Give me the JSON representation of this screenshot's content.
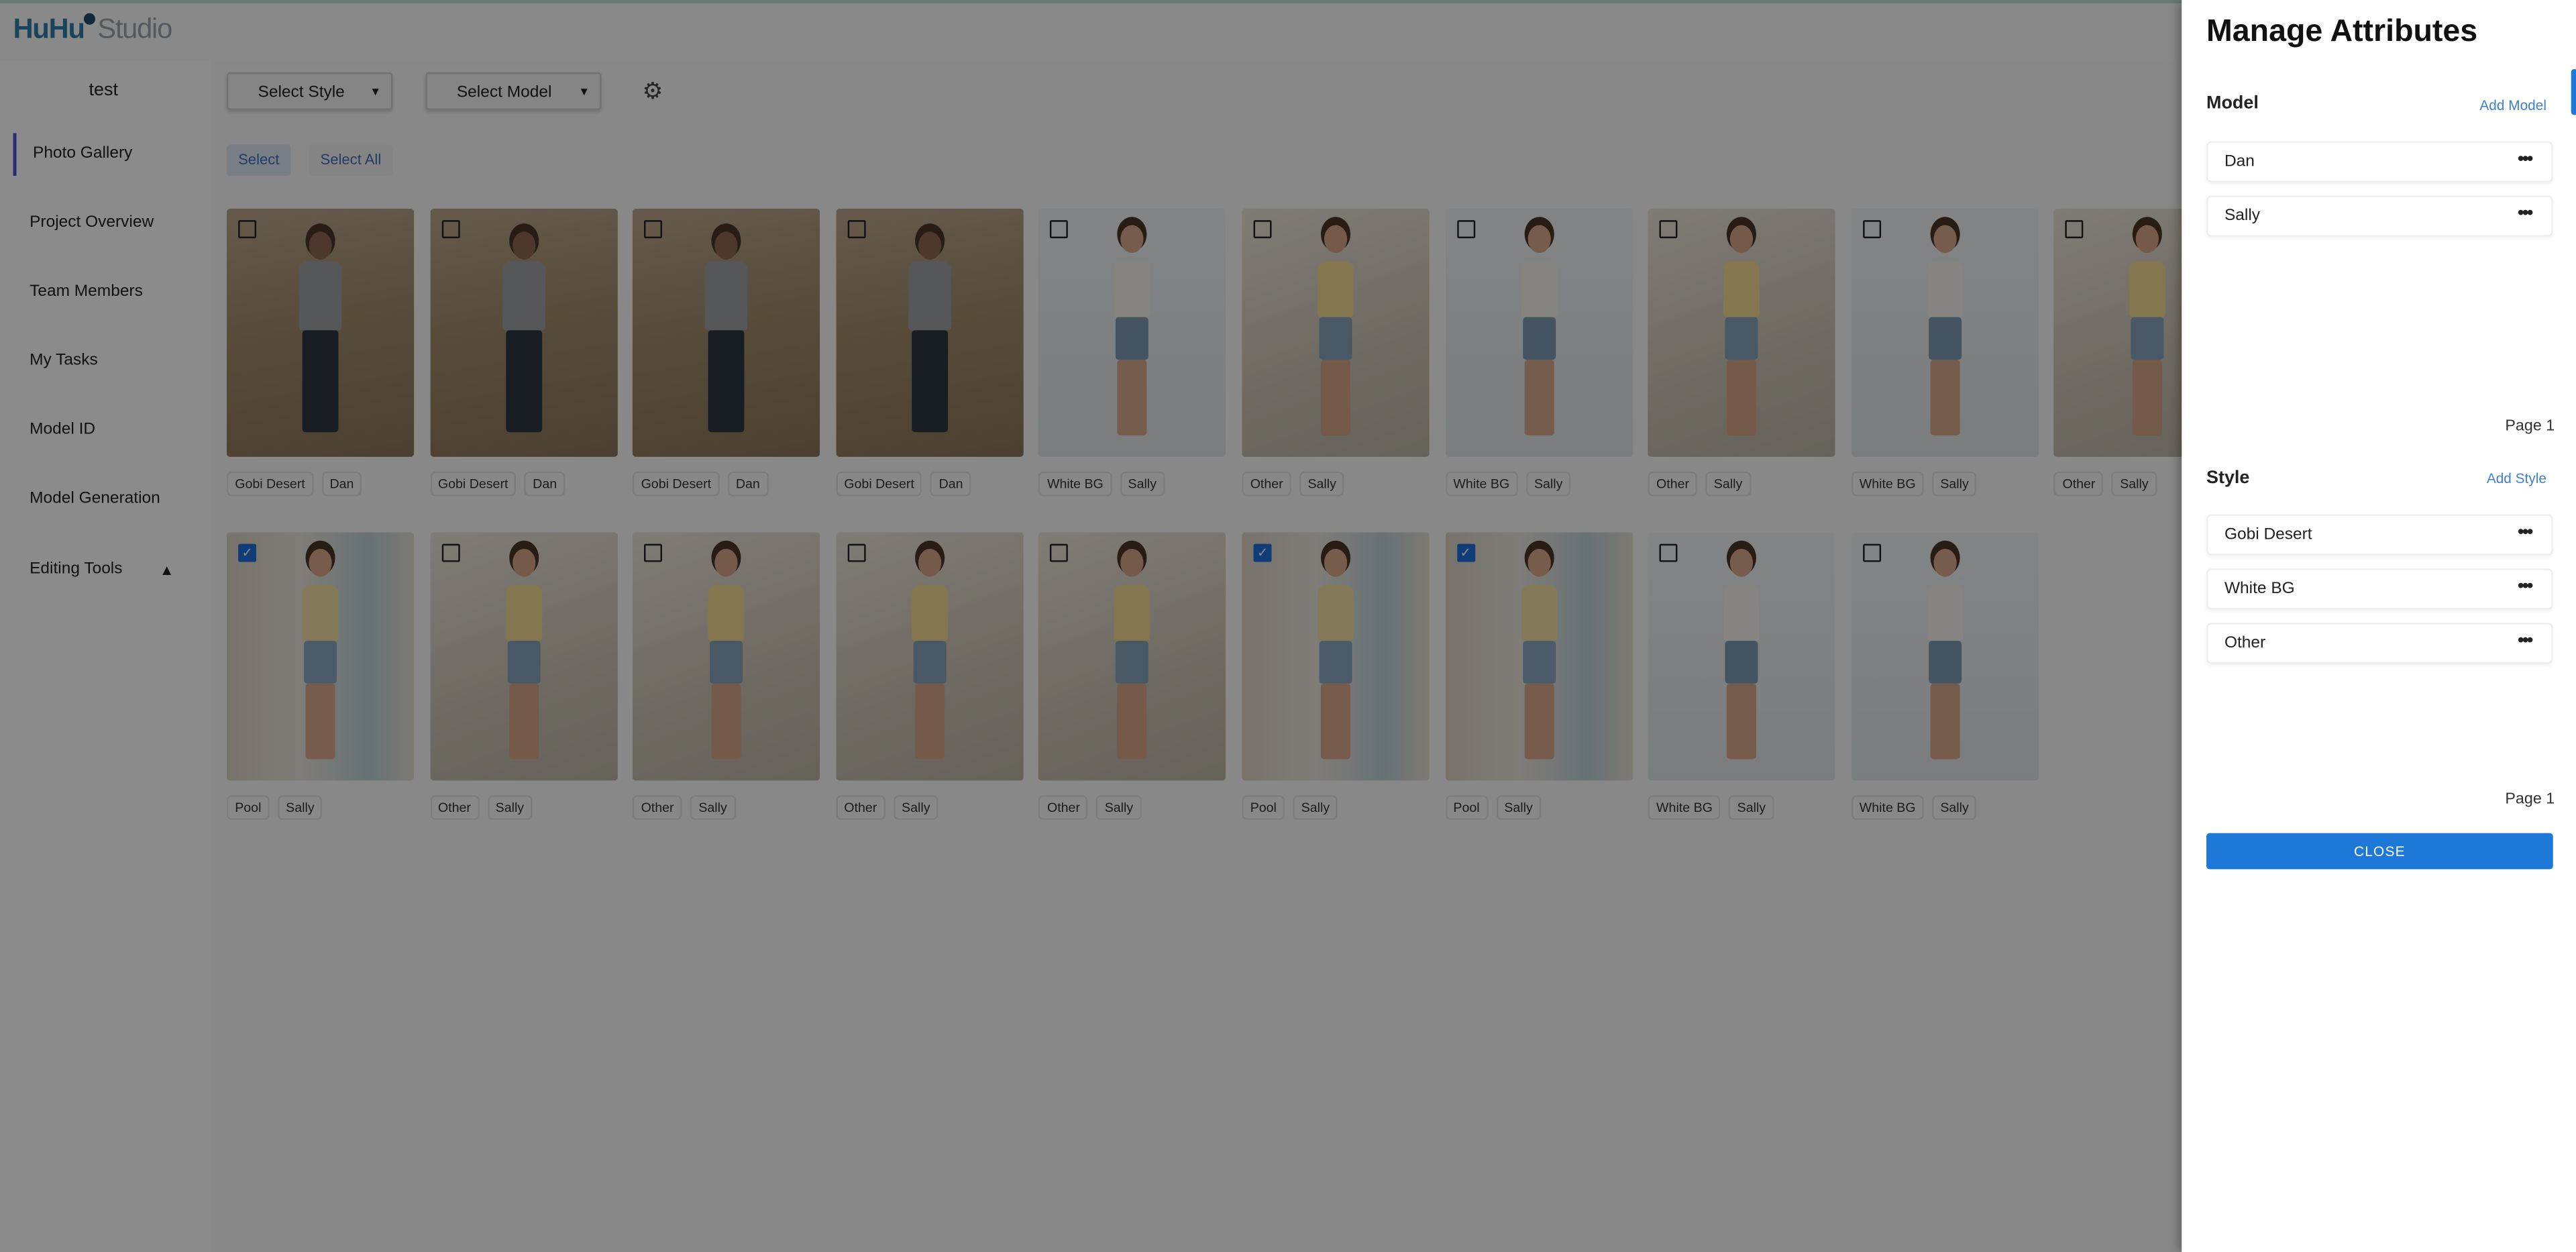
{
  "app": {
    "logo_primary": "HuHu",
    "logo_secondary": "Studio",
    "project_name": "test"
  },
  "sidebar": {
    "items": [
      {
        "label": "Photo Gallery",
        "active": true
      },
      {
        "label": "Project Overview"
      },
      {
        "label": "Team Members"
      },
      {
        "label": "My Tasks"
      },
      {
        "label": "Model ID"
      },
      {
        "label": "Model Generation"
      },
      {
        "label": "Editing Tools",
        "expanded": true
      }
    ]
  },
  "toolbar": {
    "style_select": "Select Style",
    "model_select": "Select Model",
    "settings_icon": "gear-icon",
    "select_label": "Select",
    "select_all_label": "Select All"
  },
  "gallery": {
    "rows": [
      [
        {
          "style": "Gobi Desert",
          "model": "Dan",
          "checked": false
        },
        {
          "style": "Gobi Desert",
          "model": "Dan",
          "checked": false
        },
        {
          "style": "Gobi Desert",
          "model": "Dan",
          "checked": false
        },
        {
          "style": "Gobi Desert",
          "model": "Dan",
          "checked": false
        },
        {
          "style": "White BG",
          "model": "Sally",
          "checked": false
        },
        {
          "style": "Other",
          "model": "Sally",
          "checked": false
        },
        {
          "style": "White BG",
          "model": "Sally",
          "checked": false
        },
        {
          "style": "Other",
          "model": "Sally",
          "checked": false
        },
        {
          "style": "White BG",
          "model": "Sally",
          "checked": false
        },
        {
          "style": "Other",
          "model": "Sally",
          "checked": false
        }
      ],
      [
        {
          "style": "Pool",
          "model": "Sally",
          "checked": true
        },
        {
          "style": "Other",
          "model": "Sally",
          "checked": false
        },
        {
          "style": "Other",
          "model": "Sally",
          "checked": false
        },
        {
          "style": "Other",
          "model": "Sally",
          "checked": false
        },
        {
          "style": "Other",
          "model": "Sally",
          "checked": false
        },
        {
          "style": "Pool",
          "model": "Sally",
          "checked": true
        },
        {
          "style": "Pool",
          "model": "Sally",
          "checked": true
        },
        {
          "style": "White BG",
          "model": "Sally",
          "checked": false
        },
        {
          "style": "White BG",
          "model": "Sally",
          "checked": false
        }
      ]
    ]
  },
  "panel": {
    "title": "Manage Attributes",
    "model": {
      "heading": "Model",
      "add_label": "Add Model",
      "items": [
        "Dan",
        "Sally"
      ],
      "page": "Page 1"
    },
    "style": {
      "heading": "Style",
      "add_label": "Add Style",
      "items": [
        "Gobi Desert",
        "White BG",
        "Other"
      ],
      "page": "Page 1"
    },
    "more_glyph": "•••",
    "close_label": "CLOSE"
  },
  "colors": {
    "accent": "#1e78d8",
    "link": "#3d7fd0",
    "checkbox": "#1e6fd9"
  }
}
